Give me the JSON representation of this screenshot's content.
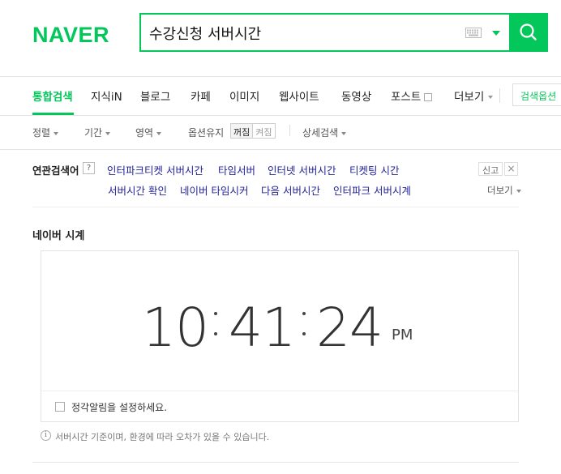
{
  "header": {
    "logo": "NAVER",
    "search_value": "수강신청 서버시간"
  },
  "tabs": [
    {
      "label": "통합검색",
      "active": true
    },
    {
      "label": "지식iN"
    },
    {
      "label": "블로그"
    },
    {
      "label": "카페"
    },
    {
      "label": "이미지"
    },
    {
      "label": "웹사이트"
    },
    {
      "label": "동영상"
    },
    {
      "label": "포스트"
    },
    {
      "label": "더보기"
    }
  ],
  "search_options_label": "검색옵션",
  "filters": {
    "sort": "정렬",
    "period": "기간",
    "area": "영역",
    "option_keep": "옵션유지",
    "toggle_on": "꺼짐",
    "toggle_off": "켜짐",
    "detail": "상세검색"
  },
  "related": {
    "title": "연관검색어",
    "help": "?",
    "links": [
      "인터파크티켓 서버시간",
      "타임서버",
      "인터넷 서버시간",
      "티켓팅 시간",
      "서버시간 확인",
      "네이버 타임시커",
      "다음 서버시간",
      "인터파크 서버시계"
    ],
    "report": "신고",
    "more": "더보기"
  },
  "clock": {
    "title": "네이버 시계",
    "hours": "10",
    "minutes": "41",
    "seconds": "24",
    "ampm": "PM",
    "alarm_label": "정각알림을 설정하세요.",
    "info_icon": "i",
    "info": "서버시간 기준이며, 환경에 따라 오차가 있을 수 있습니다."
  },
  "colors": {
    "brand": "#03c75a",
    "link": "#22229a"
  }
}
